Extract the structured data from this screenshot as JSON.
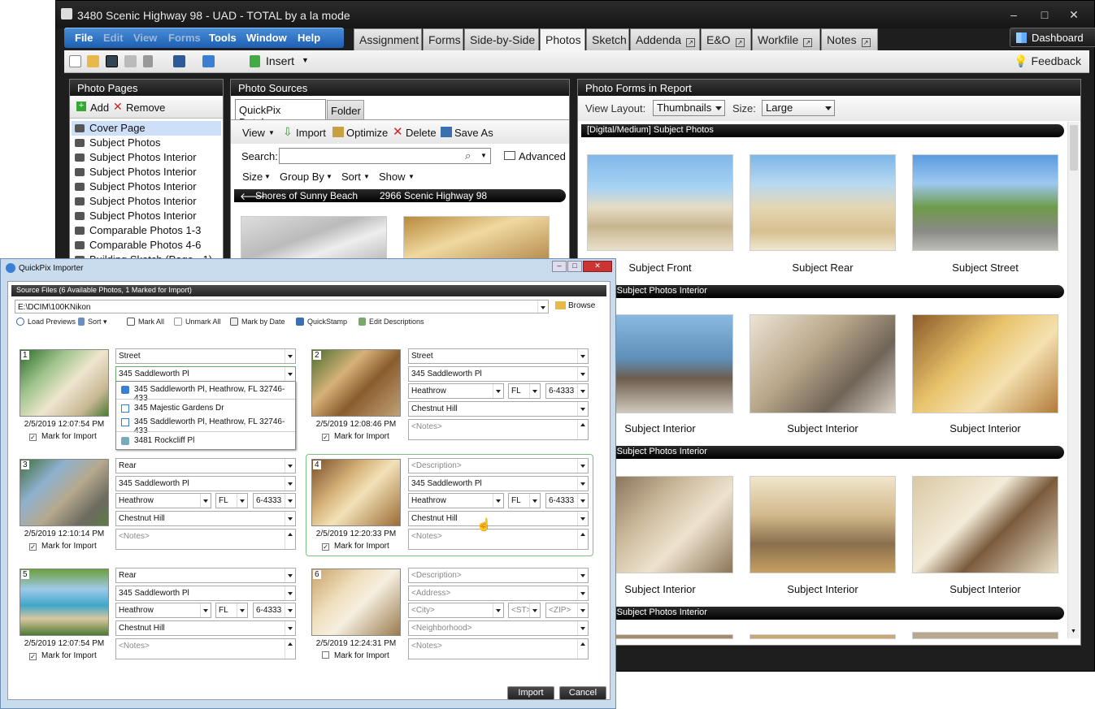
{
  "window": {
    "title": "3480 Scenic Highway 98 - UAD - TOTAL by a la mode"
  },
  "menu": [
    "File",
    "Edit",
    "View",
    "Forms",
    "Tools",
    "Window",
    "Help"
  ],
  "tabs": [
    "Assignment",
    "Forms",
    "Side-by-Side",
    "Photos",
    "Sketch",
    "Addenda",
    "E&O",
    "Workfile",
    "Notes"
  ],
  "dashboard": "Dashboard",
  "toolbar": {
    "insert": "Insert",
    "feedback": "Feedback"
  },
  "photo_pages": {
    "title": "Photo Pages",
    "add": "Add",
    "remove": "Remove",
    "items": [
      "Cover Page",
      "Subject Photos",
      "Subject Photos Interior",
      "Subject Photos Interior",
      "Subject Photos Interior",
      "Subject Photos Interior",
      "Subject Photos Interior",
      "Comparable Photos 1-3",
      "Comparable Photos 4-6",
      "Building Sketch (Page - 1)"
    ]
  },
  "photo_sources": {
    "title": "Photo Sources",
    "tabs": [
      "QuickPix Database",
      "Folder"
    ],
    "actions": [
      "View",
      "Import",
      "Optimize",
      "Delete",
      "Save As"
    ],
    "search_label": "Search:",
    "advanced": "Advanced",
    "filters": [
      "Size",
      "Group By",
      "Sort",
      "Show"
    ],
    "group_name": "Shores of Sunny Beach",
    "group_address": "2966 Scenic Highway 98"
  },
  "photo_forms": {
    "title": "Photo Forms in Report",
    "view_layout_label": "View Layout:",
    "view_layout": "Thumbnails",
    "size_label": "Size:",
    "size": "Large",
    "sections": [
      "[Digital/Medium] Subject Photos",
      "/Small] Subject Photos Interior",
      "/Small] Subject Photos Interior",
      "/Small] Subject Photos Interior"
    ],
    "captions": [
      "Subject Front",
      "Subject Rear",
      "Subject Street",
      "Subject Interior",
      "Subject Interior",
      "Subject Interior",
      "Subject Interior",
      "Subject Interior",
      "Subject Interior"
    ]
  },
  "importer": {
    "title": "QuickPix Importer",
    "source_header": "Source Files (6 Available Photos, 1 Marked for Import)",
    "path": "E:\\DCIM\\100KNikon",
    "browse": "Browse",
    "toolbar": [
      "Load Previews",
      "Sort",
      "Mark All",
      "Unmark All",
      "Mark by Date",
      "QuickStamp",
      "Edit Descriptions"
    ],
    "mark_label": "Mark for Import",
    "dropdown": [
      "345 Saddleworth Pl, Heathrow, FL  32746-433",
      "345 Majestic Gardens Dr",
      "345 Saddleworth Pl, Heathrow, FL  32746-433",
      "3481 Rockcliff Pl"
    ],
    "photos": [
      {
        "n": "1",
        "ts": "2/5/2019 12:07:54 PM",
        "desc": "Street",
        "addr": "345 Saddleworth Pl",
        "city": "",
        "st": "",
        "zip": "",
        "nbhd": "",
        "notes": "",
        "marked": true
      },
      {
        "n": "2",
        "ts": "2/5/2019 12:08:46 PM",
        "desc": "Street",
        "addr": "345 Saddleworth Pl",
        "city": "Heathrow",
        "st": "FL",
        "zip": "6-4333",
        "nbhd": "Chestnut Hill",
        "notes": "<Notes>",
        "marked": true
      },
      {
        "n": "3",
        "ts": "2/5/2019 12:10:14 PM",
        "desc": "Rear",
        "addr": "345 Saddleworth Pl",
        "city": "Heathrow",
        "st": "FL",
        "zip": "6-4333",
        "nbhd": "Chestnut Hill",
        "notes": "<Notes>",
        "marked": true
      },
      {
        "n": "4",
        "ts": "2/5/2019 12:20:33 PM",
        "desc": "<Description>",
        "addr": "345 Saddleworth Pl",
        "city": "Heathrow",
        "st": "FL",
        "zip": "6-4333",
        "nbhd": "Chestnut Hill",
        "notes": "<Notes>",
        "marked": true
      },
      {
        "n": "5",
        "ts": "2/5/2019 12:07:54 PM",
        "desc": "Rear",
        "addr": "345 Saddleworth Pl",
        "city": "Heathrow",
        "st": "FL",
        "zip": "6-4333",
        "nbhd": "Chestnut Hill",
        "notes": "<Notes>",
        "marked": true
      },
      {
        "n": "6",
        "ts": "2/5/2019 12:24:31 PM",
        "desc": "<Description>",
        "addr": "<Address>",
        "city": "<City>",
        "st": "<ST>",
        "zip": "<ZIP>",
        "nbhd": "<Neighborhood>",
        "notes": "<Notes>",
        "marked": false
      }
    ],
    "import": "Import",
    "cancel": "Cancel"
  }
}
